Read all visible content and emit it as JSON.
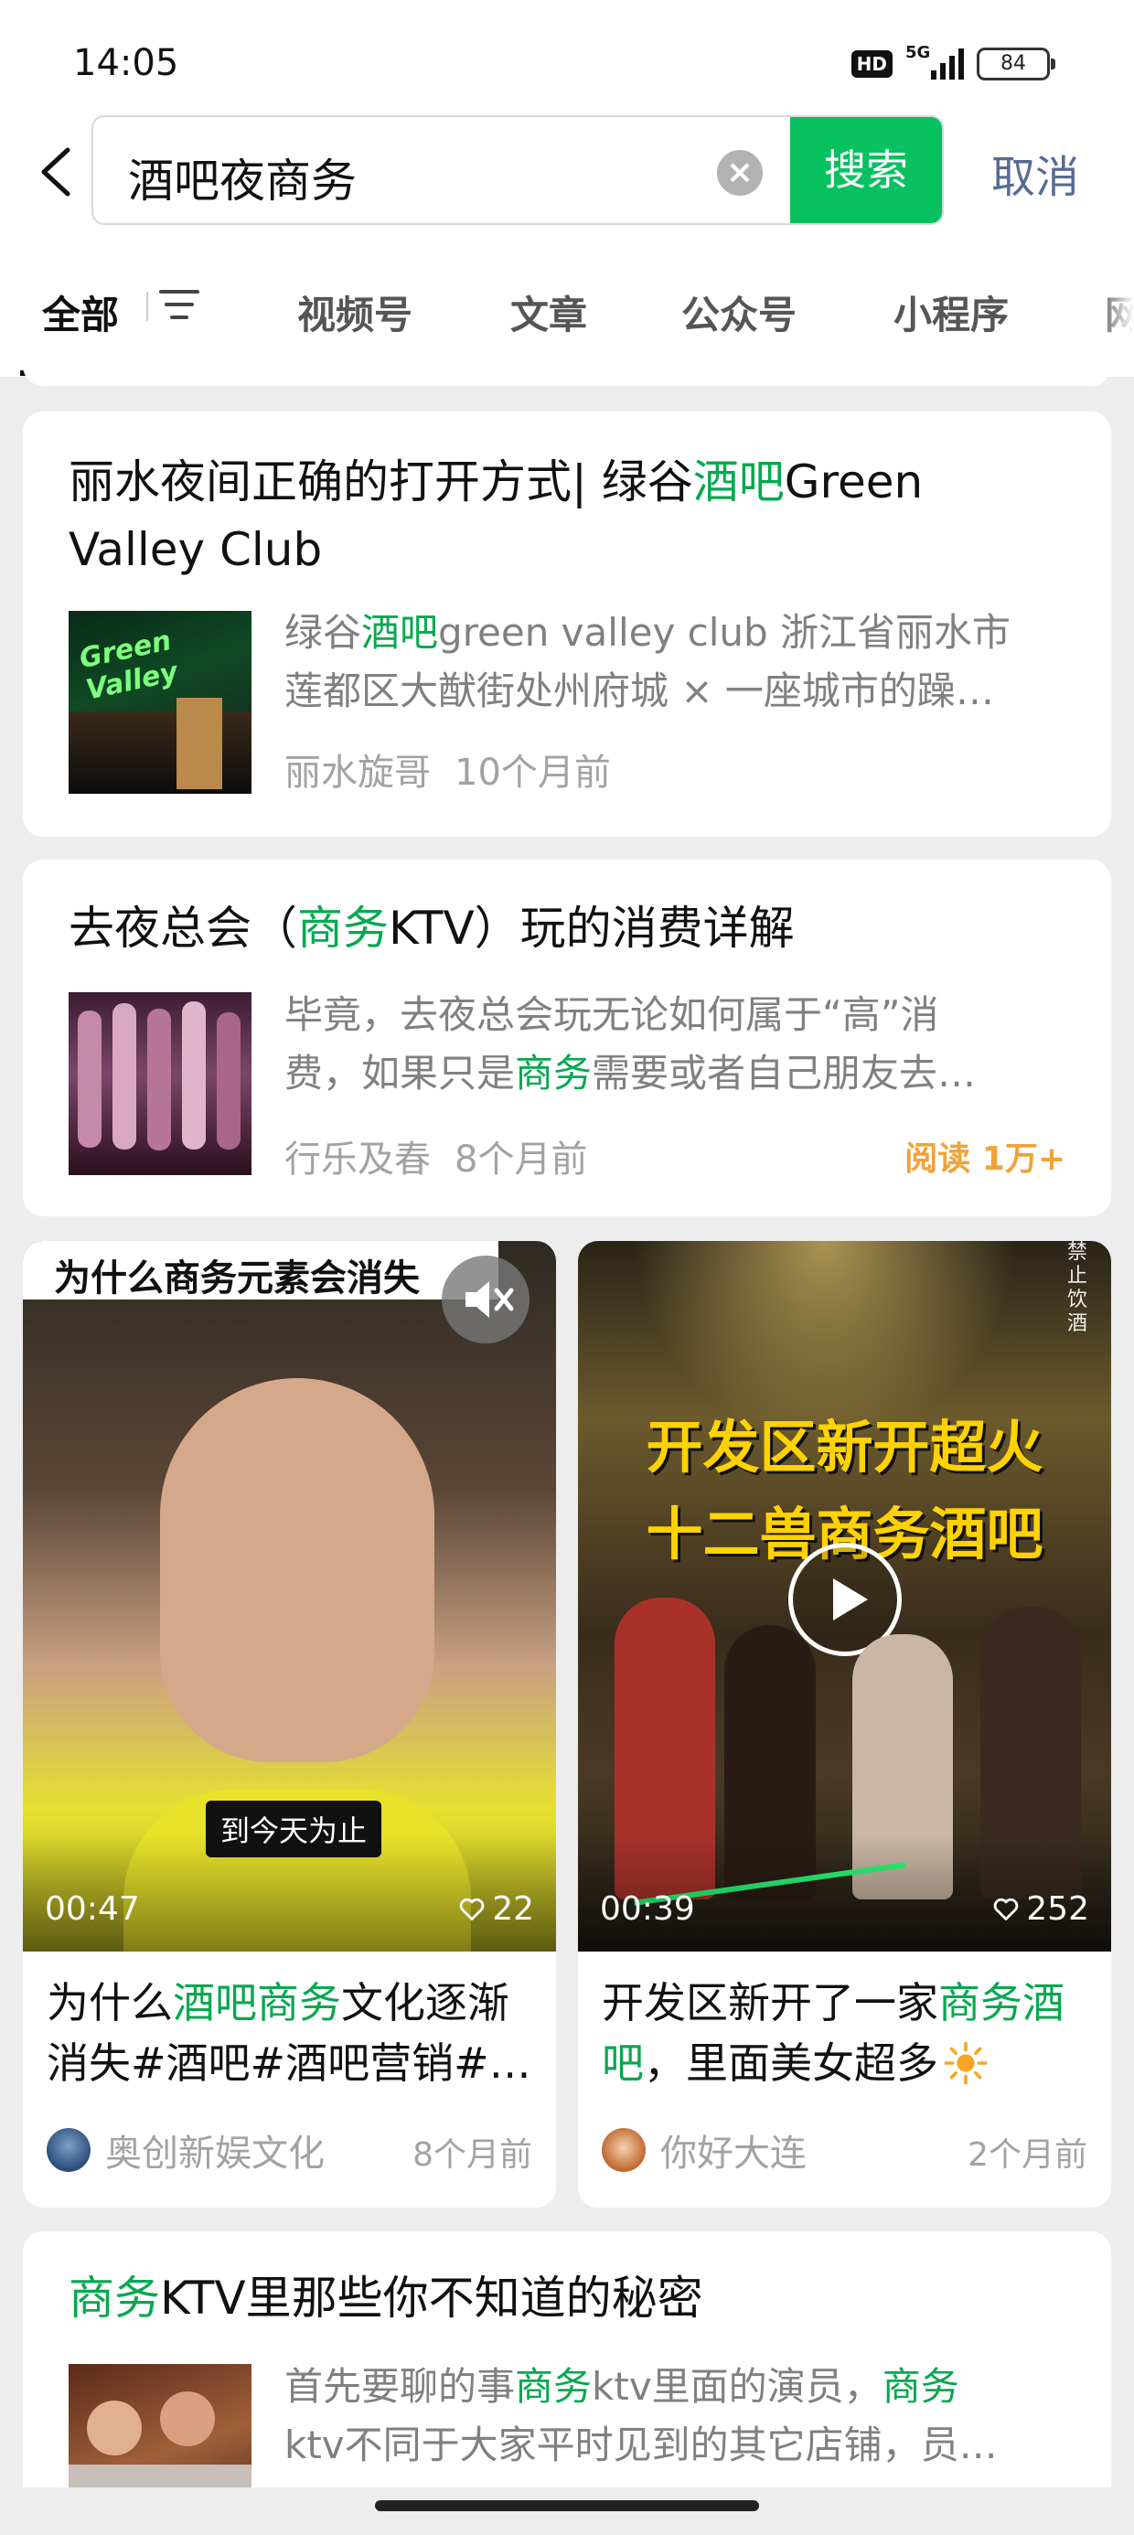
{
  "status": {
    "time": "14:05",
    "hd": "HD",
    "network": "5G",
    "battery": "84"
  },
  "search": {
    "query": "酒吧夜商务",
    "button": "搜索",
    "cancel": "取消"
  },
  "tabs": [
    "全部",
    "视频号",
    "文章",
    "公众号",
    "小程序",
    "网"
  ],
  "results": [
    {
      "title_a": "丽水夜间正确的打开方式| 绿谷",
      "title_hl": "酒吧",
      "title_b": "Green",
      "title_line2": "Valley Club",
      "snippet_a": "绿谷",
      "snippet_hl": "酒吧",
      "snippet_b": "green valley club 浙江省丽水市",
      "snippet_line2": "莲都区大猷街处州府城 × 一座城市的躁…",
      "thumb_text": "Green Valley",
      "author": "丽水旋哥",
      "time": "10个月前"
    },
    {
      "title_a": "去夜总会（",
      "title_hl": "商务",
      "title_b": "KTV）玩的消费详解",
      "snippet_line1": "毕竟，去夜总会玩无论如何属于“高”消",
      "snippet2_a": "费，如果只是",
      "snippet2_hl": "商务",
      "snippet2_b": "需要或者自己朋友去…",
      "author": "行乐及春",
      "time": "8个月前",
      "reads": "阅读 1万+"
    },
    {
      "title_hl": "商务",
      "title_b": "KTV里那些你不知道的秘密",
      "snippet1_a": "首先要聊的事",
      "snippet1_hl1": "商务",
      "snippet1_b": "ktv里面的演员，",
      "snippet1_hl2": "商务",
      "snippet_line2": "ktv不同于大家平时见到的其它店铺，员…"
    }
  ],
  "videos": [
    {
      "overlay_title": "为什么商务元素会消失",
      "caption": "到今天为止",
      "duration": "00:47",
      "likes": "22",
      "title_a": "为什么",
      "title_hl": "酒吧商务",
      "title_b": "文化逐渐",
      "title_line2": "消失#酒吧#酒吧营销#…",
      "author": "奥创新娱文化",
      "time": "8个月前"
    },
    {
      "overlay_line1": "开发区新开超火",
      "overlay_line2": "十二兽商务酒吧",
      "side_text": "禁止饮酒",
      "duration": "00:39",
      "likes": "252",
      "title_a": "开发区新开了一家",
      "title_hl": "商务酒",
      "title_hl2": "吧",
      "title_b": "，里面美女超多",
      "author": "你好大连",
      "time": "2个月前"
    }
  ],
  "colors": {
    "accent": "#07c160",
    "highlight": "#07a84f",
    "link": "#576b95",
    "reads": "#f0a33a"
  }
}
